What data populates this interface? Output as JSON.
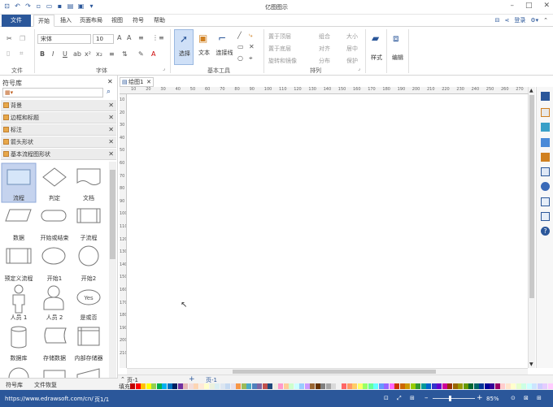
{
  "app": {
    "title": "亿图图示",
    "login_label": "登录"
  },
  "tabs": [
    {
      "label": "文件"
    },
    {
      "label": "开始"
    },
    {
      "label": "插入"
    },
    {
      "label": "页面布局"
    },
    {
      "label": "视图"
    },
    {
      "label": "符号"
    },
    {
      "label": "帮助"
    }
  ],
  "ribbon": {
    "font_name": "宋体",
    "font_size": "10",
    "groups": {
      "file": "文件",
      "font": "字体",
      "basic_tools": "基本工具",
      "arrange": "排列"
    },
    "tools": {
      "select": "选择",
      "text": "文本",
      "connector": "连接线",
      "style": "样式",
      "edit": "编辑"
    },
    "arrange": {
      "bring_front": "置于顶层",
      "send_back": "置于底层",
      "rotate": "旋转和镜像",
      "group": "组合",
      "align": "对齐",
      "distribute": "分布",
      "size": "大小",
      "center": "居中",
      "protect": "保护"
    }
  },
  "library": {
    "title": "符号库",
    "categories": [
      {
        "label": "背景"
      },
      {
        "label": "边框和标题"
      },
      {
        "label": "标注"
      },
      {
        "label": "箭头形状"
      },
      {
        "label": "基本流程图形状"
      }
    ],
    "shapes": [
      {
        "label": "流程",
        "icon": "process-shape"
      },
      {
        "label": "判定",
        "icon": "decision-shape"
      },
      {
        "label": "文档",
        "icon": "document-shape"
      },
      {
        "label": "数据",
        "icon": "data-shape"
      },
      {
        "label": "开始或结束",
        "icon": "terminator-shape"
      },
      {
        "label": "子流程",
        "icon": "subprocess-shape"
      },
      {
        "label": "预定义流程",
        "icon": "predefined-process-shape"
      },
      {
        "label": "开始1",
        "icon": "ellipse-shape"
      },
      {
        "label": "开始2",
        "icon": "circle-shape"
      },
      {
        "label": "人员 1",
        "icon": "person1-shape"
      },
      {
        "label": "人员 2",
        "icon": "person2-shape"
      },
      {
        "label": "是或否",
        "icon": "yes-no-shape"
      },
      {
        "label": "数据库",
        "icon": "database-shape"
      },
      {
        "label": "存储数据",
        "icon": "stored-data-shape"
      },
      {
        "label": "内部存储器",
        "icon": "internal-storage-shape"
      }
    ],
    "yes_text": "Yes",
    "bottom_tabs": [
      "符号库",
      "文件恢复"
    ]
  },
  "document": {
    "tab_label": "绘图1",
    "page_label": "页-1",
    "active_page": "页-1"
  },
  "ruler": {
    "h_ticks": [
      "10",
      "20",
      "30",
      "40",
      "50",
      "60",
      "70",
      "80",
      "90",
      "100",
      "110",
      "120",
      "130",
      "140",
      "150",
      "160",
      "170",
      "180",
      "190",
      "200",
      "210",
      "220",
      "230",
      "240",
      "250",
      "260",
      "270",
      "280"
    ],
    "v_ticks": [
      "10",
      "20",
      "30",
      "40",
      "50",
      "60",
      "70",
      "80",
      "90",
      "100",
      "110",
      "120",
      "130",
      "140",
      "150",
      "160",
      "170",
      "180",
      "190",
      "200",
      "210"
    ]
  },
  "status": {
    "url": "https://www.edrawsoft.com/cn/",
    "page_info": "页1/1",
    "zoom": "85%",
    "fill_label": "填充"
  },
  "palette_colors": [
    "#c00000",
    "#ff0000",
    "#ffc000",
    "#ffff00",
    "#92d050",
    "#00b050",
    "#00b0f0",
    "#0070c0",
    "#002060",
    "#7030a0",
    "#e6b8b7",
    "#f2dcdb",
    "#fcd5b4",
    "#fde9d9",
    "#ffffcc",
    "#ebf1de",
    "#daeef3",
    "#dce6f1",
    "#c5d9f1",
    "#e4dfec",
    "#f79646",
    "#9bbb59",
    "#4bacc6",
    "#4f81bd",
    "#8064a2",
    "#c0504d",
    "#1f497d",
    "#eeece1",
    "#ff99cc",
    "#ffcc99",
    "#ccffcc",
    "#ccffff",
    "#99ccff",
    "#cc99ff",
    "#996633",
    "#663300",
    "#808080",
    "#a6a6a6",
    "#d9d9d9",
    "#f2f2f2",
    "#ff6666",
    "#ff9966",
    "#ffcc66",
    "#ffff66",
    "#99ff66",
    "#66ff99",
    "#66ffff",
    "#6699ff",
    "#9966ff",
    "#ff66ff",
    "#cc3300",
    "#cc6600",
    "#cc9900",
    "#99cc00",
    "#339933",
    "#009999",
    "#0066cc",
    "#3333cc",
    "#6600cc",
    "#cc0099",
    "#993300",
    "#996600",
    "#999900",
    "#669900",
    "#006633",
    "#006666",
    "#003399",
    "#000099",
    "#330099",
    "#990066",
    "#ffcccc",
    "#ffe5cc",
    "#ffffcc",
    "#e5ffcc",
    "#ccffe5",
    "#ccffff",
    "#cce5ff",
    "#ccccff",
    "#e5ccff",
    "#ffccff"
  ]
}
